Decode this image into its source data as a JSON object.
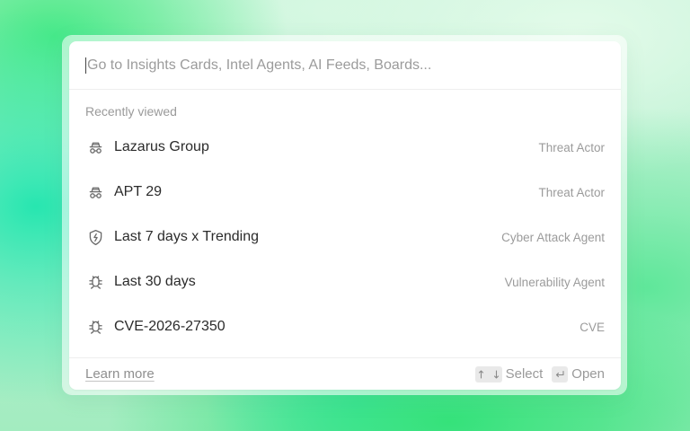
{
  "search": {
    "placeholder": "Go to Insights Cards, Intel Agents, AI Feeds, Boards..."
  },
  "recent": {
    "heading": "Recently viewed",
    "items": [
      {
        "label": "Lazarus Group",
        "type": "Threat Actor",
        "icon": "spy-icon"
      },
      {
        "label": "APT 29",
        "type": "Threat Actor",
        "icon": "spy-icon"
      },
      {
        "label": "Last 7 days x Trending",
        "type": "Cyber Attack Agent",
        "icon": "shield-bolt-icon"
      },
      {
        "label": "Last 30 days",
        "type": "Vulnerability Agent",
        "icon": "bug-icon"
      },
      {
        "label": "CVE-2026-27350",
        "type": "CVE",
        "icon": "bug-icon"
      }
    ]
  },
  "footer": {
    "learn_more": "Learn more",
    "select_label": "Select",
    "open_label": "Open"
  },
  "colors": {
    "background_accent": "#35e27a",
    "panel": "#ffffff",
    "muted_text": "#9b9b9b",
    "primary_text": "#2b2b2b"
  }
}
